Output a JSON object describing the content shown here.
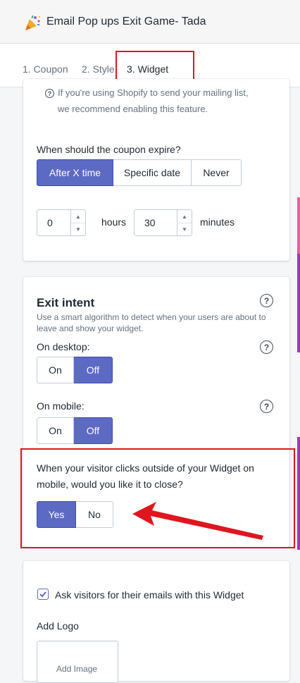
{
  "header": {
    "app_title": "Email Pop ups Exit Game- Tada"
  },
  "tabs": [
    {
      "label": "1. Coupon",
      "active": false
    },
    {
      "label": "2. Style",
      "active": false
    },
    {
      "label": "3. Widget",
      "active": true
    }
  ],
  "coupon_card": {
    "notice_line1": "If you're using Shopify to send your mailing list,",
    "notice_line2": "we recommend enabling this feature.",
    "expire_label": "When should the coupon expire?",
    "expire_options": [
      "After X time",
      "Specific date",
      "Never"
    ],
    "expire_selected": "After X time",
    "hours_value": "0",
    "hours_label": "hours",
    "minutes_value": "30",
    "minutes_label": "minutes"
  },
  "exit_intent": {
    "title": "Exit intent",
    "description": "Use a smart algorithm to detect when your users are about to leave and show your widget.",
    "desktop_label": "On desktop:",
    "mobile_label": "On mobile:",
    "on_label": "On",
    "off_label": "Off",
    "desktop_selected": "Off",
    "mobile_selected": "Off",
    "close_question": "When your visitor clicks outside of your Widget on mobile, would you like it to close?",
    "yes_label": "Yes",
    "no_label": "No",
    "close_selected": "Yes"
  },
  "logo_card": {
    "ask_emails_label": "Ask visitors for their emails with this Widget",
    "ask_emails_checked": true,
    "add_logo_label": "Add Logo",
    "add_image_label": "Add Image"
  },
  "colors": {
    "accent": "#5c6ac4",
    "annotation": "#e0161f"
  }
}
